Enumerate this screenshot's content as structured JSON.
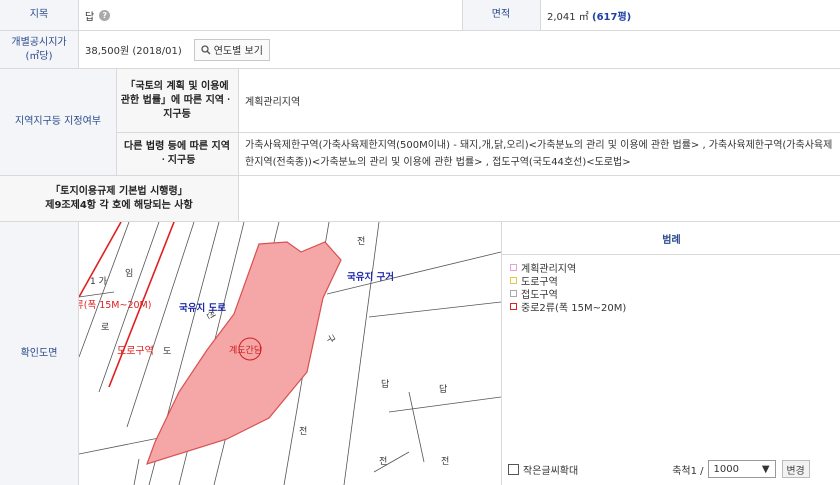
{
  "jimok": {
    "label": "지목",
    "value": "답",
    "help_icon": "question-icon"
  },
  "area": {
    "label": "면적",
    "value": "2,041 ㎡",
    "pyeong": "(617평)"
  },
  "price": {
    "label_line1": "개별공시지가",
    "label_line2": "(㎡당)",
    "value": "38,500원 (2018/01)",
    "button": "연도별 보기",
    "button_icon": "search-icon"
  },
  "zone": {
    "label": "지역지구등 지정여부",
    "row1_label": "「국토의 계획 및 이용에 관한 법률」에 따른 지역ㆍ지구등",
    "row1_value": "계획관리지역",
    "row2_label": "다른 법령 등에 따른 지역ㆍ지구등",
    "row2_value": "가축사육제한구역(가축사육제한지역(500M이내) - 돼지,개,닭,오리)<가축분뇨의 관리 및 이용에 관한 법률> , 가축사육제한구역(가축사육제한지역(전축종))<가축분뇨의 관리 및 이용에 관한 법률> , 접도구역(국도44호선)<도로법>"
  },
  "rule": {
    "line1": "「토지이용규제 기본법 시행령」",
    "line2": "제9조제4항 각 호에 해당되는 사항",
    "value": ""
  },
  "confirm": {
    "label": "확인도면"
  },
  "map": {
    "labels": [
      "국유지 구거",
      "국유지 도로",
      "전",
      "전",
      "전",
      "답",
      "답",
      "전",
      "전",
      "1 가",
      "임",
      "로",
      "도로구역",
      "류(폭 15M~20M)",
      "도",
      "계도간담",
      "구"
    ]
  },
  "legend": {
    "title": "범례",
    "items": [
      {
        "label": "계획관리지역",
        "color": "#e8a0d8"
      },
      {
        "label": "도로구역",
        "color": "#e6c84a"
      },
      {
        "label": "접도구역",
        "color": "#a8a8a8"
      },
      {
        "label": "중로2류(폭 15M~20M)",
        "color": "#e02020"
      }
    ],
    "zoom_text": "작은글씨확대",
    "scale_label": "축척1 /",
    "scale_value": "1000",
    "change_button": "변경"
  }
}
